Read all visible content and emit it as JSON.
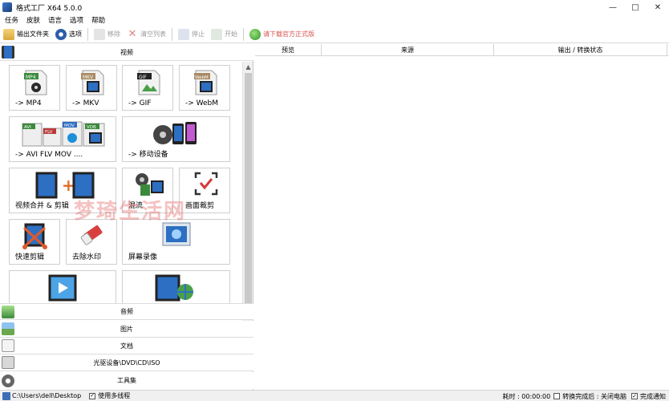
{
  "window": {
    "title": "格式工厂 X64 5.0.0",
    "minimize": "—",
    "maximize": "□",
    "close": "✕"
  },
  "menubar": [
    "任务",
    "皮肤",
    "语言",
    "选项",
    "帮助"
  ],
  "toolbar": {
    "output_folder": "输出文件夹",
    "options": "选项",
    "remove": "移除",
    "clear_list": "清空列表",
    "stop": "停止",
    "start": "开始",
    "download": "请下载官方正式版"
  },
  "categories": {
    "video": "视频",
    "audio": "音频",
    "image": "图片",
    "document": "文档",
    "optical": "光驱设备\\DVD\\CD\\ISO",
    "tools": "工具集"
  },
  "tiles": {
    "mp4": "-> MP4",
    "mkv": "-> MKV",
    "gif": "-> GIF",
    "webm": "-> WebM",
    "avi": "-> AVI FLV MOV ....",
    "mobile": "-> 移动设备",
    "merge": "视频合并 & 剪辑",
    "mix": "混流",
    "crop": "画面裁剪",
    "quick_clip": "快速剪辑",
    "remove_wm": "去除水印",
    "screen_rec": "屏幕录像",
    "icon_labels": {
      "mp4": "MP4",
      "mkv": "MKV",
      "gif": "GIF",
      "webm": "WebM",
      "avi": "AVI",
      "flv": "FLV",
      "mov": "MOV",
      "vob": "VOB"
    }
  },
  "table": {
    "columns": [
      "预览",
      "来源",
      "输出 / 转换状态"
    ]
  },
  "watermark": "梦琦生活网",
  "statusbar": {
    "path": "C:\\Users\\dell\\Desktop",
    "multithread": "使用多线程",
    "elapsed": "耗时 : 00:00:00",
    "after_convert": "转换完成后 : 关闭电脑",
    "notify": "完成通知",
    "check": "✓"
  },
  "colors": {
    "accent": "#3d6fb6",
    "download": "#d9534f",
    "film": "#2d6fc2"
  }
}
